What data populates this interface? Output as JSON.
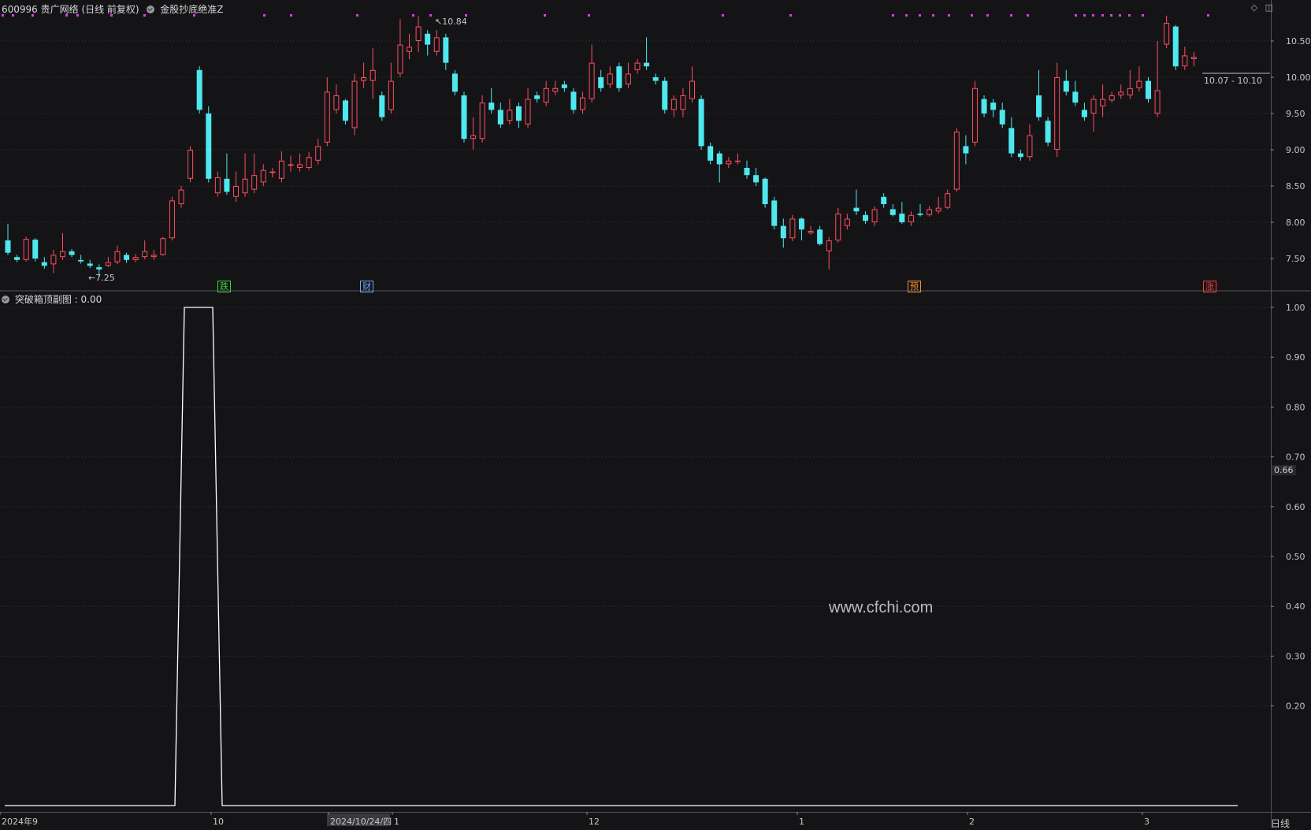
{
  "header": {
    "stock": "600996 贵广网络 (日线 前复权)",
    "indicator": "金股抄底绝准Z"
  },
  "sub_header": {
    "indicator": "突破箱顶副图",
    "value": ": 0.00"
  },
  "signals": [
    {
      "label": "跌",
      "color": "#3fd23f"
    },
    {
      "label": "财",
      "color": "#6fa8ff"
    },
    {
      "label": "预",
      "color": "#ff8c2a"
    },
    {
      "label": "涨",
      "color": "#ff3b3b"
    }
  ],
  "price_markers": {
    "high": "10.84",
    "low": "7.25",
    "range": "10.07 - 10.10"
  },
  "watermark": "www.cfchi.com",
  "period_label": "日线",
  "cursor_value": "0.66",
  "colors": {
    "up": "#ff4d5e",
    "down": "#4ee8ef",
    "grid": "#3a3a3e",
    "line": "#ffffff",
    "dots": "#e838e8"
  },
  "chart_data": [
    {
      "type": "candlestick",
      "title": "600996 贵广网络 (日线 前复权)",
      "ylim": [
        7.2,
        10.9
      ],
      "yticks": [
        "10.50",
        "10.00",
        "9.50",
        "9.00",
        "8.50",
        "8.00",
        "7.50"
      ],
      "candles": [
        [
          7.75,
          7.58,
          7.98,
          7.55
        ],
        [
          7.52,
          7.48,
          7.55,
          7.45
        ],
        [
          7.48,
          7.77,
          7.8,
          7.46
        ],
        [
          7.76,
          7.5,
          7.78,
          7.46
        ],
        [
          7.45,
          7.4,
          7.52,
          7.36
        ],
        [
          7.42,
          7.55,
          7.62,
          7.3
        ],
        [
          7.52,
          7.6,
          7.85,
          7.48
        ],
        [
          7.6,
          7.55,
          7.63,
          7.52
        ],
        [
          7.48,
          7.46,
          7.55,
          7.43
        ],
        [
          7.43,
          7.4,
          7.48,
          7.37
        ],
        [
          7.38,
          7.35,
          7.42,
          7.25
        ],
        [
          7.4,
          7.45,
          7.52,
          7.38
        ],
        [
          7.45,
          7.6,
          7.68,
          7.42
        ],
        [
          7.55,
          7.48,
          7.58,
          7.44
        ],
        [
          7.48,
          7.52,
          7.56,
          7.45
        ],
        [
          7.52,
          7.6,
          7.75,
          7.49
        ],
        [
          7.52,
          7.55,
          7.62,
          7.48
        ],
        [
          7.55,
          7.78,
          7.8,
          7.54
        ],
        [
          7.78,
          8.3,
          8.35,
          7.75
        ],
        [
          8.25,
          8.45,
          8.5,
          8.2
        ],
        [
          8.6,
          9.0,
          9.05,
          8.55
        ],
        [
          10.1,
          9.55,
          10.15,
          9.5
        ],
        [
          9.5,
          8.6,
          9.6,
          8.55
        ],
        [
          8.4,
          8.62,
          8.7,
          8.35
        ],
        [
          8.6,
          8.42,
          8.95,
          8.38
        ],
        [
          8.35,
          8.5,
          8.7,
          8.28
        ],
        [
          8.4,
          8.6,
          8.95,
          8.35
        ],
        [
          8.45,
          8.65,
          8.95,
          8.4
        ],
        [
          8.55,
          8.72,
          8.8,
          8.5
        ],
        [
          8.68,
          8.7,
          8.75,
          8.62
        ],
        [
          8.6,
          8.85,
          8.98,
          8.55
        ],
        [
          8.78,
          8.8,
          8.92,
          8.7
        ],
        [
          8.75,
          8.8,
          8.95,
          8.7
        ],
        [
          8.75,
          8.9,
          8.97,
          8.72
        ],
        [
          8.85,
          9.05,
          9.15,
          8.8
        ],
        [
          9.1,
          9.8,
          10.0,
          9.05
        ],
        [
          9.55,
          9.75,
          9.9,
          9.5
        ],
        [
          9.68,
          9.4,
          9.7,
          9.35
        ],
        [
          9.3,
          9.95,
          10.05,
          9.2
        ],
        [
          9.95,
          10.0,
          10.2,
          9.85
        ],
        [
          9.95,
          10.1,
          10.4,
          9.7
        ],
        [
          9.75,
          9.45,
          9.8,
          9.4
        ],
        [
          9.55,
          9.95,
          10.2,
          9.5
        ],
        [
          10.05,
          10.45,
          10.8,
          10.0
        ],
        [
          10.35,
          10.42,
          10.6,
          10.25
        ],
        [
          10.5,
          10.7,
          10.84,
          10.35
        ],
        [
          10.6,
          10.45,
          10.65,
          10.3
        ],
        [
          10.35,
          10.55,
          10.65,
          10.3
        ],
        [
          10.55,
          10.2,
          10.6,
          10.1
        ],
        [
          10.05,
          9.8,
          10.1,
          9.75
        ],
        [
          9.75,
          9.15,
          9.8,
          9.1
        ],
        [
          9.15,
          9.2,
          9.45,
          9.0
        ],
        [
          9.15,
          9.65,
          9.75,
          9.1
        ],
        [
          9.65,
          9.55,
          9.85,
          9.5
        ],
        [
          9.55,
          9.35,
          9.65,
          9.3
        ],
        [
          9.4,
          9.55,
          9.7,
          9.35
        ],
        [
          9.6,
          9.4,
          9.65,
          9.3
        ],
        [
          9.35,
          9.7,
          9.85,
          9.3
        ],
        [
          9.75,
          9.7,
          9.8,
          9.65
        ],
        [
          9.65,
          9.85,
          9.95,
          9.6
        ],
        [
          9.8,
          9.85,
          9.95,
          9.75
        ],
        [
          9.9,
          9.85,
          9.95,
          9.8
        ],
        [
          9.8,
          9.55,
          9.85,
          9.5
        ],
        [
          9.55,
          9.72,
          9.8,
          9.5
        ],
        [
          9.7,
          10.2,
          10.45,
          9.65
        ],
        [
          10.0,
          9.85,
          10.1,
          9.8
        ],
        [
          9.9,
          10.05,
          10.15,
          9.85
        ],
        [
          10.15,
          9.85,
          10.2,
          9.8
        ],
        [
          9.9,
          10.05,
          10.2,
          9.85
        ],
        [
          10.1,
          10.2,
          10.25,
          10.05
        ],
        [
          10.2,
          10.15,
          10.55,
          10.1
        ],
        [
          10.0,
          9.95,
          10.05,
          9.9
        ],
        [
          9.95,
          9.55,
          10.0,
          9.5
        ],
        [
          9.55,
          9.7,
          9.75,
          9.45
        ],
        [
          9.55,
          9.75,
          9.85,
          9.45
        ],
        [
          9.7,
          9.95,
          10.15,
          9.65
        ],
        [
          9.7,
          9.05,
          9.75,
          9.0
        ],
        [
          9.05,
          8.85,
          9.1,
          8.8
        ],
        [
          8.95,
          8.8,
          8.98,
          8.55
        ],
        [
          8.8,
          8.85,
          8.9,
          8.75
        ],
        [
          8.85,
          8.85,
          8.95,
          8.8
        ],
        [
          8.75,
          8.65,
          8.85,
          8.6
        ],
        [
          8.65,
          8.55,
          8.75,
          8.5
        ],
        [
          8.6,
          8.25,
          8.62,
          8.2
        ],
        [
          8.3,
          7.95,
          8.35,
          7.9
        ],
        [
          7.95,
          7.78,
          8.05,
          7.65
        ],
        [
          7.78,
          8.05,
          8.1,
          7.74
        ],
        [
          8.05,
          7.9,
          8.07,
          7.75
        ],
        [
          7.85,
          7.88,
          7.95,
          7.83
        ],
        [
          7.9,
          7.7,
          7.95,
          7.68
        ],
        [
          7.6,
          7.75,
          7.8,
          7.35
        ],
        [
          7.75,
          8.12,
          8.2,
          7.72
        ],
        [
          7.95,
          8.05,
          8.12,
          7.9
        ],
        [
          8.2,
          8.15,
          8.45,
          8.1
        ],
        [
          8.1,
          8.02,
          8.15,
          7.98
        ],
        [
          8.0,
          8.18,
          8.22,
          7.95
        ],
        [
          8.35,
          8.25,
          8.4,
          8.2
        ],
        [
          8.18,
          8.1,
          8.25,
          8.08
        ],
        [
          8.12,
          8.0,
          8.28,
          7.98
        ],
        [
          8.0,
          8.1,
          8.15,
          7.95
        ],
        [
          8.12,
          8.1,
          8.25,
          8.08
        ],
        [
          8.1,
          8.18,
          8.22,
          8.08
        ],
        [
          8.15,
          8.2,
          8.35,
          8.12
        ],
        [
          8.2,
          8.4,
          8.45,
          8.18
        ],
        [
          8.45,
          9.25,
          9.3,
          8.42
        ],
        [
          9.05,
          8.95,
          9.2,
          8.8
        ],
        [
          9.1,
          9.85,
          9.95,
          9.05
        ],
        [
          9.7,
          9.5,
          9.75,
          9.45
        ],
        [
          9.65,
          9.55,
          9.7,
          9.45
        ],
        [
          9.55,
          9.35,
          9.65,
          9.3
        ],
        [
          9.3,
          8.95,
          9.45,
          8.9
        ],
        [
          8.95,
          8.9,
          9.0,
          8.85
        ],
        [
          8.9,
          9.2,
          9.35,
          8.85
        ],
        [
          9.75,
          9.45,
          10.1,
          9.4
        ],
        [
          9.4,
          9.1,
          9.45,
          9.05
        ],
        [
          9.0,
          10.0,
          10.2,
          8.9
        ],
        [
          9.95,
          9.8,
          10.1,
          9.75
        ],
        [
          9.8,
          9.65,
          9.95,
          9.6
        ],
        [
          9.55,
          9.45,
          9.65,
          9.4
        ],
        [
          9.5,
          9.7,
          9.75,
          9.25
        ],
        [
          9.6,
          9.7,
          9.9,
          9.45
        ],
        [
          9.68,
          9.75,
          9.8,
          9.65
        ],
        [
          9.75,
          9.8,
          9.9,
          9.7
        ],
        [
          9.75,
          9.85,
          10.1,
          9.7
        ],
        [
          9.85,
          9.95,
          10.15,
          9.8
        ],
        [
          9.95,
          9.7,
          10.0,
          9.65
        ],
        [
          9.5,
          9.82,
          10.5,
          9.45
        ],
        [
          10.45,
          10.75,
          10.85,
          10.4
        ],
        [
          10.7,
          10.15,
          10.72,
          10.1
        ],
        [
          10.15,
          10.3,
          10.42,
          10.1
        ],
        [
          10.25,
          10.28,
          10.35,
          10.15
        ]
      ],
      "up_color": "#ff4d5e",
      "down_color": "#4ee8ef"
    },
    {
      "type": "line",
      "title": "突破箱顶副图",
      "ylim": [
        0,
        1
      ],
      "yticks": [
        "1.00",
        "0.90",
        "0.80",
        "0.70",
        "0.60",
        "0.50",
        "0.40",
        "0.30",
        "0.20"
      ],
      "points": [
        [
          0,
          0
        ],
        [
          19,
          0
        ],
        [
          20,
          1
        ],
        [
          22,
          1
        ],
        [
          23,
          0
        ],
        [
          134,
          0
        ]
      ],
      "xlabels": [
        "2024年9",
        "10",
        "2024/10/24/四",
        "1",
        "12",
        "1",
        "2",
        "3"
      ]
    }
  ]
}
